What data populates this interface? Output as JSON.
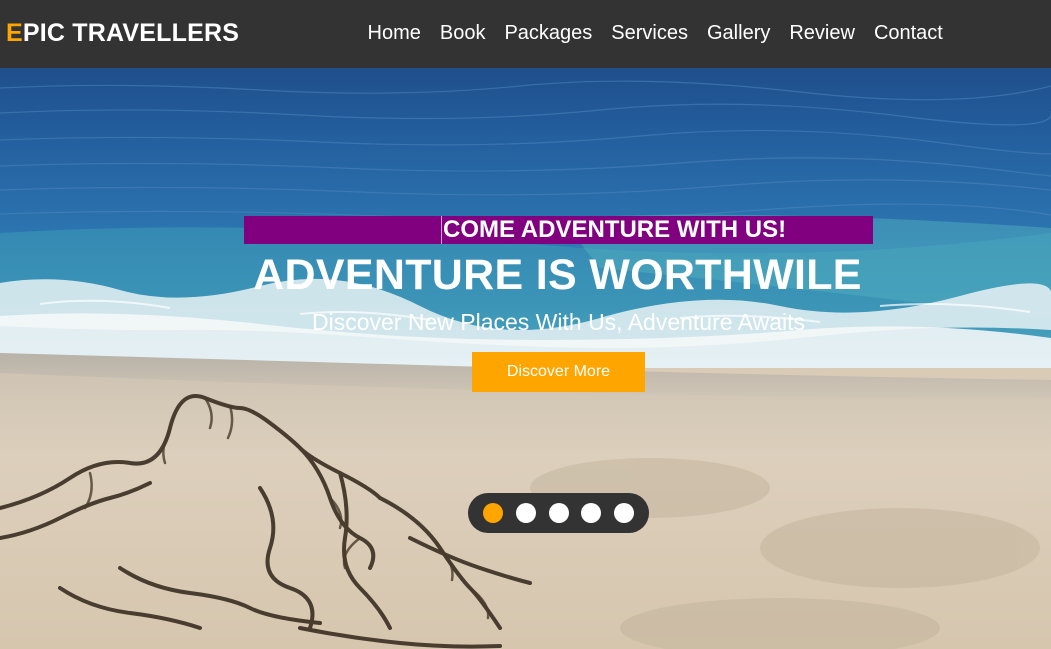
{
  "brand": {
    "first_letter": "E",
    "rest": "PIC TRAVELLERS",
    "accent_color": "#ffa500"
  },
  "nav": {
    "items": [
      "Home",
      "Book",
      "Packages",
      "Services",
      "Gallery",
      "Review",
      "Contact"
    ]
  },
  "hero": {
    "tagline": "COME ADVENTURE WITH US!",
    "title": "ADVENTURE IS WORTHWILE",
    "subtitle": "Discover New Places With Us, Adventure Awaits",
    "cta_label": "Discover More",
    "tagline_bg": "#800080",
    "cta_bg": "#ffa500"
  },
  "slider": {
    "total_slides": 5,
    "active_slide": 1
  },
  "colors": {
    "header_bg": "#333333",
    "text": "#ffffff"
  }
}
